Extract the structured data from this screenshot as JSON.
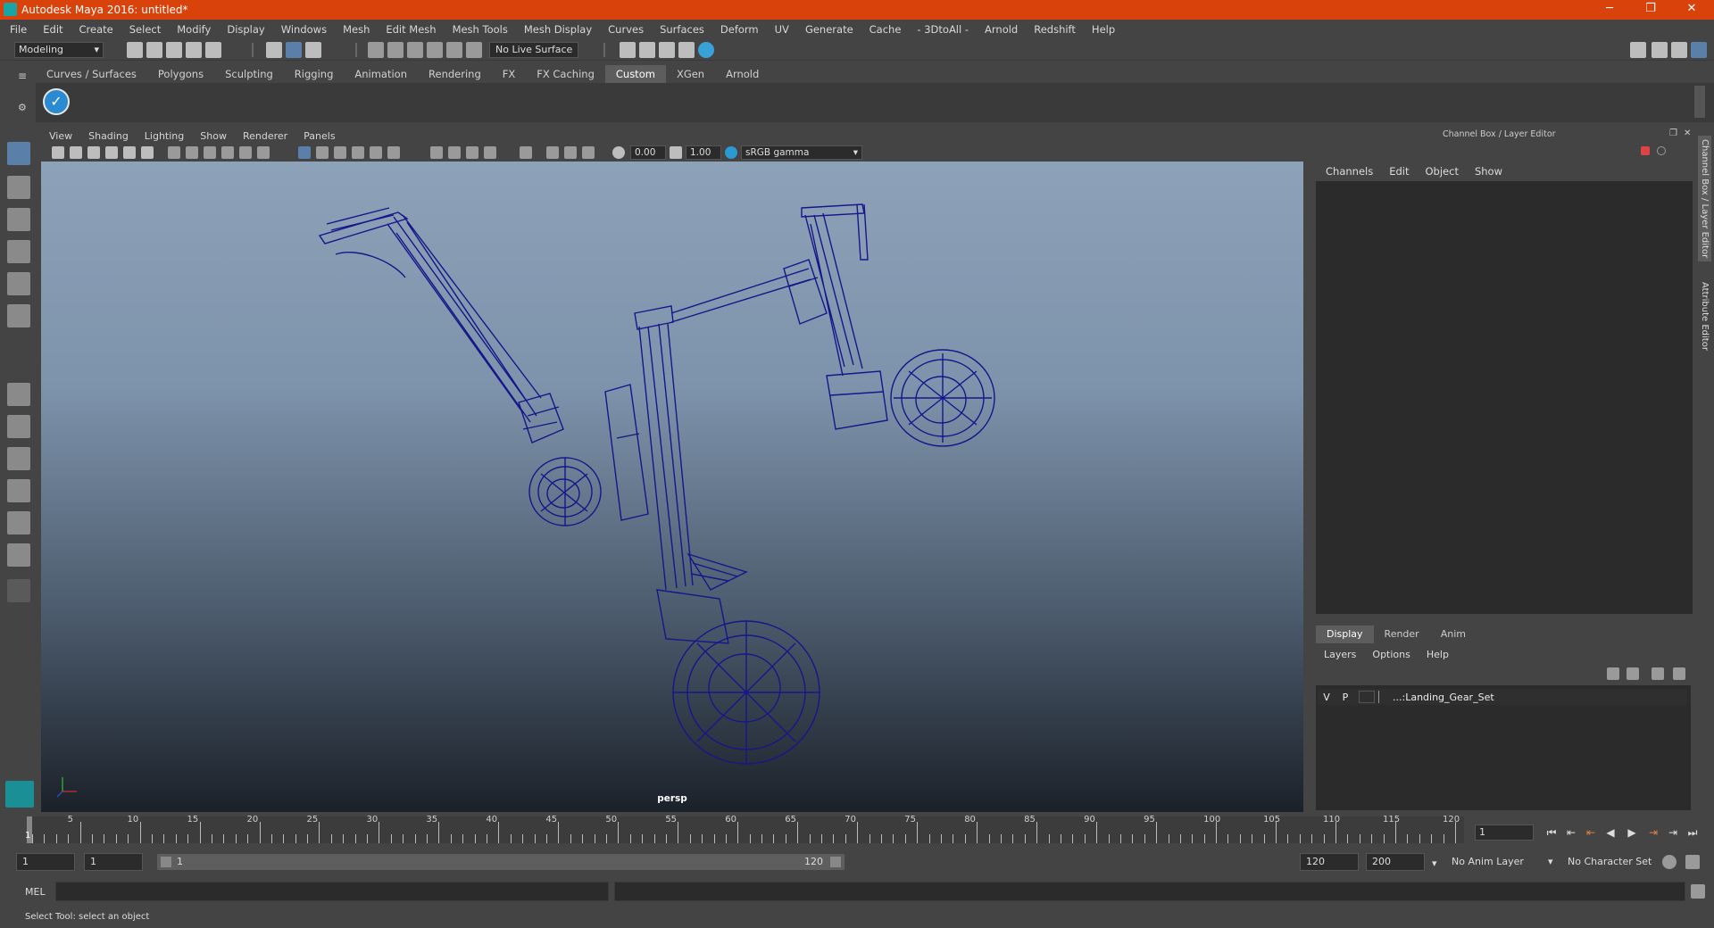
{
  "window": {
    "title": "Autodesk Maya 2016: untitled*",
    "minimize": "─",
    "maximize": "❐",
    "close": "✕"
  },
  "menus": [
    "File",
    "Edit",
    "Create",
    "Select",
    "Modify",
    "Display",
    "Windows",
    "Mesh",
    "Edit Mesh",
    "Mesh Tools",
    "Mesh Display",
    "Curves",
    "Surfaces",
    "Deform",
    "UV",
    "Generate",
    "Cache",
    "- 3DtoAll -",
    "Arnold",
    "Redshift",
    "Help"
  ],
  "statusline": {
    "mode": "Modeling",
    "live_surface": "No Live Surface"
  },
  "shelf": {
    "tabs": [
      "Curves / Surfaces",
      "Polygons",
      "Sculpting",
      "Rigging",
      "Animation",
      "Rendering",
      "FX",
      "FX Caching",
      "Custom",
      "XGen",
      "Arnold"
    ],
    "active": "Custom"
  },
  "viewport": {
    "menus": [
      "View",
      "Shading",
      "Lighting",
      "Show",
      "Renderer",
      "Panels"
    ],
    "exposure": "0.00",
    "gamma": "1.00",
    "color_space": "sRGB gamma",
    "camera_label": "persp",
    "wire_color": "#1a1a8a"
  },
  "channel_box": {
    "title": "Channel Box / Layer Editor",
    "menus": [
      "Channels",
      "Edit",
      "Object",
      "Show"
    ]
  },
  "layer_editor": {
    "tabs": [
      "Display",
      "Render",
      "Anim"
    ],
    "active_tab": "Display",
    "menus": [
      "Layers",
      "Options",
      "Help"
    ],
    "layers": [
      {
        "v": "V",
        "p": "P",
        "name": "...:Landing_Gear_Set"
      }
    ]
  },
  "side_tabs": [
    "Channel Box / Layer Editor",
    "Attribute Editor"
  ],
  "timeline": {
    "ticks": [
      "5",
      "10",
      "15",
      "20",
      "25",
      "30",
      "35",
      "40",
      "45",
      "50",
      "55",
      "60",
      "65",
      "70",
      "75",
      "80",
      "85",
      "90",
      "95",
      "100",
      "105",
      "110",
      "115",
      "120"
    ],
    "current_marker": "1",
    "current_frame": "1"
  },
  "range": {
    "start": "1",
    "anim_start": "1",
    "range_start": "1",
    "range_end": "120",
    "end": "120",
    "anim_end": "200",
    "anim_layer": "No Anim Layer",
    "character_set": "No Character Set"
  },
  "command": {
    "label": "MEL"
  },
  "help_line": "Select Tool: select an object"
}
